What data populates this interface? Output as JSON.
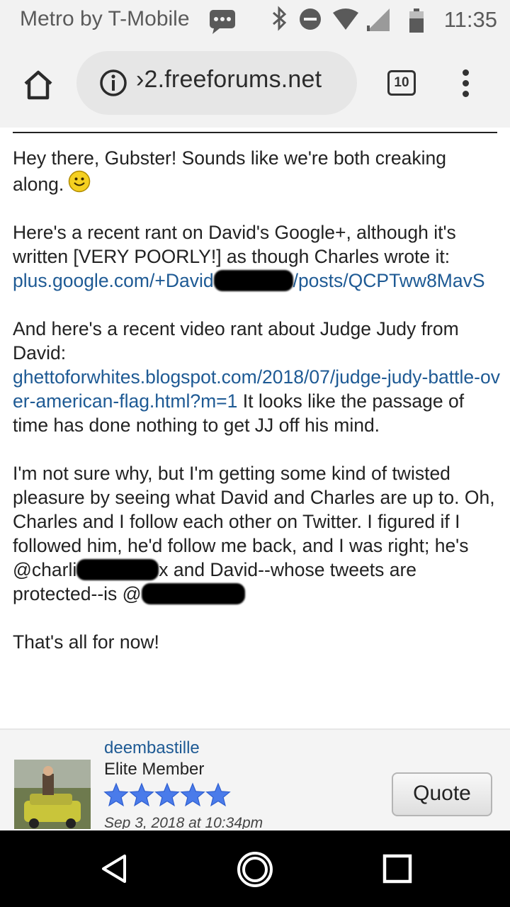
{
  "status_bar": {
    "carrier": "Metro by T-Mobile",
    "time": "11:35",
    "icons": [
      "message-icon",
      "bluetooth-icon",
      "do-not-disturb-icon",
      "wifi-icon",
      "cell-signal-icon",
      "battery-icon"
    ]
  },
  "browser": {
    "url": "›2.freeforums.net",
    "tab_count": "10",
    "icons": [
      "home-icon",
      "info-icon",
      "tabs-icon",
      "overflow-menu-icon"
    ]
  },
  "post": {
    "p1_text": "Hey there, Gubster! Sounds like we're both creaking along.",
    "p2_text": "Here's a recent rant on David's Google+, although it's written [VERY POORLY!] as though Charles wrote it:",
    "p2_link_a": "plus.google.com/+David",
    "p2_link_b": "/posts/QCPTww8MavS",
    "p3_text": "And here's a recent video rant about Judge Judy from David:",
    "p3_link": "ghettoforwhites.blogspot.com/2018/07/judge-judy-battle-over-american-flag.html?m=1",
    "p3_tail": "It looks like the passage of time has done nothing to get JJ off his mind.",
    "p4_text_a": "I'm not sure why, but I'm getting some kind of twisted pleasure by seeing what David and Charles are up to. Oh, Charles and I follow each other on Twitter. I figured if I followed him, he'd follow me back, and I was right; he's @charli",
    "p4_text_b": "x and David--whose tweets are protected--is @",
    "p5_text": "That's all for now!"
  },
  "author": {
    "username": "deembastille",
    "rank": "Elite Member",
    "star_count": 5,
    "post_date": "Sep 3, 2018 at 10:34pm",
    "quote_label": "Quote"
  },
  "colors": {
    "link": "#1e5a94",
    "star": "#4a7bea",
    "nav_bar": "#000000"
  },
  "nav": {
    "icons": [
      "back-icon",
      "home-circle-icon",
      "recents-icon"
    ]
  }
}
